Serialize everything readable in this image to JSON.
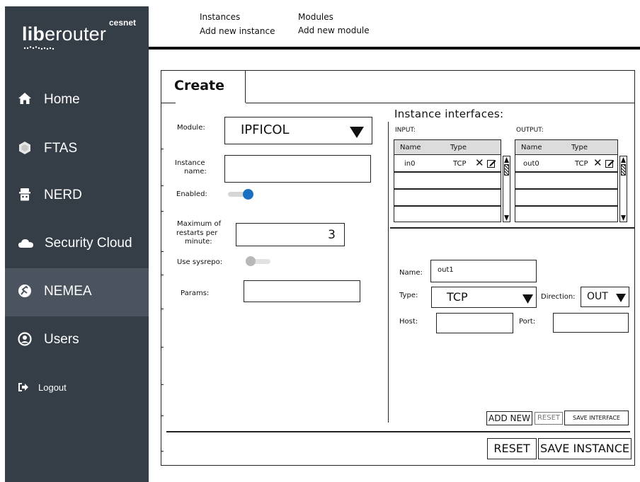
{
  "sidebar": {
    "logo_text_bold": "lib",
    "logo_text_rest": "erouter",
    "logo_cesnet": "cesnet",
    "items": [
      {
        "label": "Home",
        "icon": "home-icon"
      },
      {
        "label": "FTAS",
        "icon": "ftas-icon"
      },
      {
        "label": "NERD",
        "icon": "nerd-icon"
      },
      {
        "label": "Security Cloud",
        "icon": "cloud-icon"
      },
      {
        "label": "NEMEA",
        "icon": "nemea-icon"
      },
      {
        "label": "Users",
        "icon": "user-icon"
      },
      {
        "label": "Logout",
        "icon": "logout-icon"
      }
    ],
    "active_item": "NEMEA",
    "bg_color": "#353d47",
    "active_color": "#4a535e"
  },
  "topnav": {
    "instances": "Instances",
    "add_instance": "Add new instance",
    "modules": "Modules",
    "add_module": "Add new module"
  },
  "panel": {
    "tab_title": "Create",
    "module_label": "Module:",
    "module_value": "IPFICOL",
    "instance_name_label_1": "Instance",
    "instance_name_label_2": "name:",
    "instance_name_value": "",
    "enabled_label": "Enabled:",
    "enabled": true,
    "max_restarts_label_1": "Maximum of",
    "max_restarts_label_2": "restarts per",
    "max_restarts_label_3": "minute:",
    "max_restarts_value": "3",
    "use_sysrepo_label": "Use sysrepo:",
    "use_sysrepo": false,
    "params_label": "Params:",
    "params_value": "",
    "reset_label": "RESET",
    "save_instance_label": "SAVE INSTANCE"
  },
  "interfaces": {
    "title": "Instance interfaces:",
    "input_label": "INPUT:",
    "output_label": "OUTPUT:",
    "col_name": "Name",
    "col_type": "Type",
    "input_rows": [
      {
        "name": "in0",
        "type": "TCP"
      }
    ],
    "output_rows": [
      {
        "name": "out0",
        "type": "TCP"
      }
    ],
    "form": {
      "name_label": "Name:",
      "name_value": "out1",
      "type_label": "Type:",
      "type_value": "TCP",
      "direction_label": "Direction:",
      "direction_value": "OUT",
      "host_label": "Host:",
      "host_value": "",
      "port_label": "Port:",
      "port_value": ""
    },
    "add_new_label": "ADD NEW",
    "reset_label": "RESET",
    "save_interface_label": "SAVE INTERFACE"
  },
  "colors": {
    "toggle_on": "#1a6fc0",
    "toggle_off": "#b8b8b8"
  }
}
